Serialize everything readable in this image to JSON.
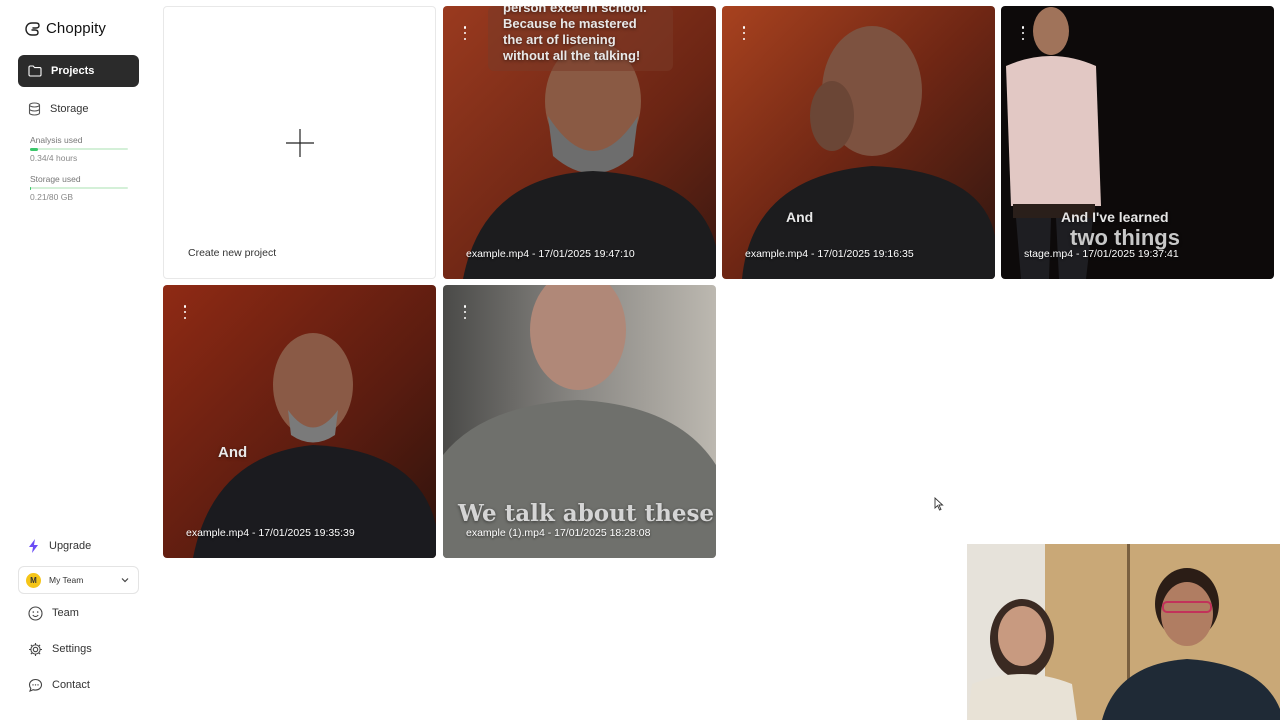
{
  "app": {
    "name": "Choppity"
  },
  "sidebar": {
    "nav": [
      {
        "label": "Projects",
        "icon": "folder-icon",
        "active": true
      },
      {
        "label": "Storage",
        "icon": "database-icon",
        "active": false
      }
    ],
    "usage": [
      {
        "label": "Analysis used",
        "value": "0.34/4 hours",
        "fraction": 0.085
      },
      {
        "label": "Storage used",
        "value": "0.21/80 GB",
        "fraction": 0.003
      }
    ],
    "upgrade_label": "Upgrade",
    "team_select": {
      "avatar_letter": "M",
      "value": "My Team"
    },
    "bottom_nav": [
      {
        "label": "Team",
        "icon": "smiley-icon"
      },
      {
        "label": "Settings",
        "icon": "gear-icon"
      },
      {
        "label": "Contact",
        "icon": "chat-bubble-icon"
      }
    ]
  },
  "projects": {
    "new_project_label": "Create new project",
    "items": [
      {
        "label": "example.mp4 - 17/01/2025 19:47:10",
        "caption": "person excel in school.\nBecause he mastered\nthe art of listening\nwithout all the talking!"
      },
      {
        "label": "example.mp4 - 17/01/2025 19:16:35",
        "caption": "And"
      },
      {
        "label": "stage.mp4 - 17/01/2025 19:37:41",
        "caption": "And I've learned",
        "caption2": "two things"
      },
      {
        "label": "example.mp4 - 17/01/2025 19:35:39",
        "caption": "And"
      },
      {
        "label": "example (1).mp4 - 17/01/2025 18:28:08",
        "caption": "We talk about these"
      }
    ]
  },
  "colors": {
    "active_nav_bg": "#2b2b2b",
    "usage_fill": "#3cc76b",
    "upgrade_icon": "#6a4cf5",
    "team_avatar": "#f5c518"
  }
}
